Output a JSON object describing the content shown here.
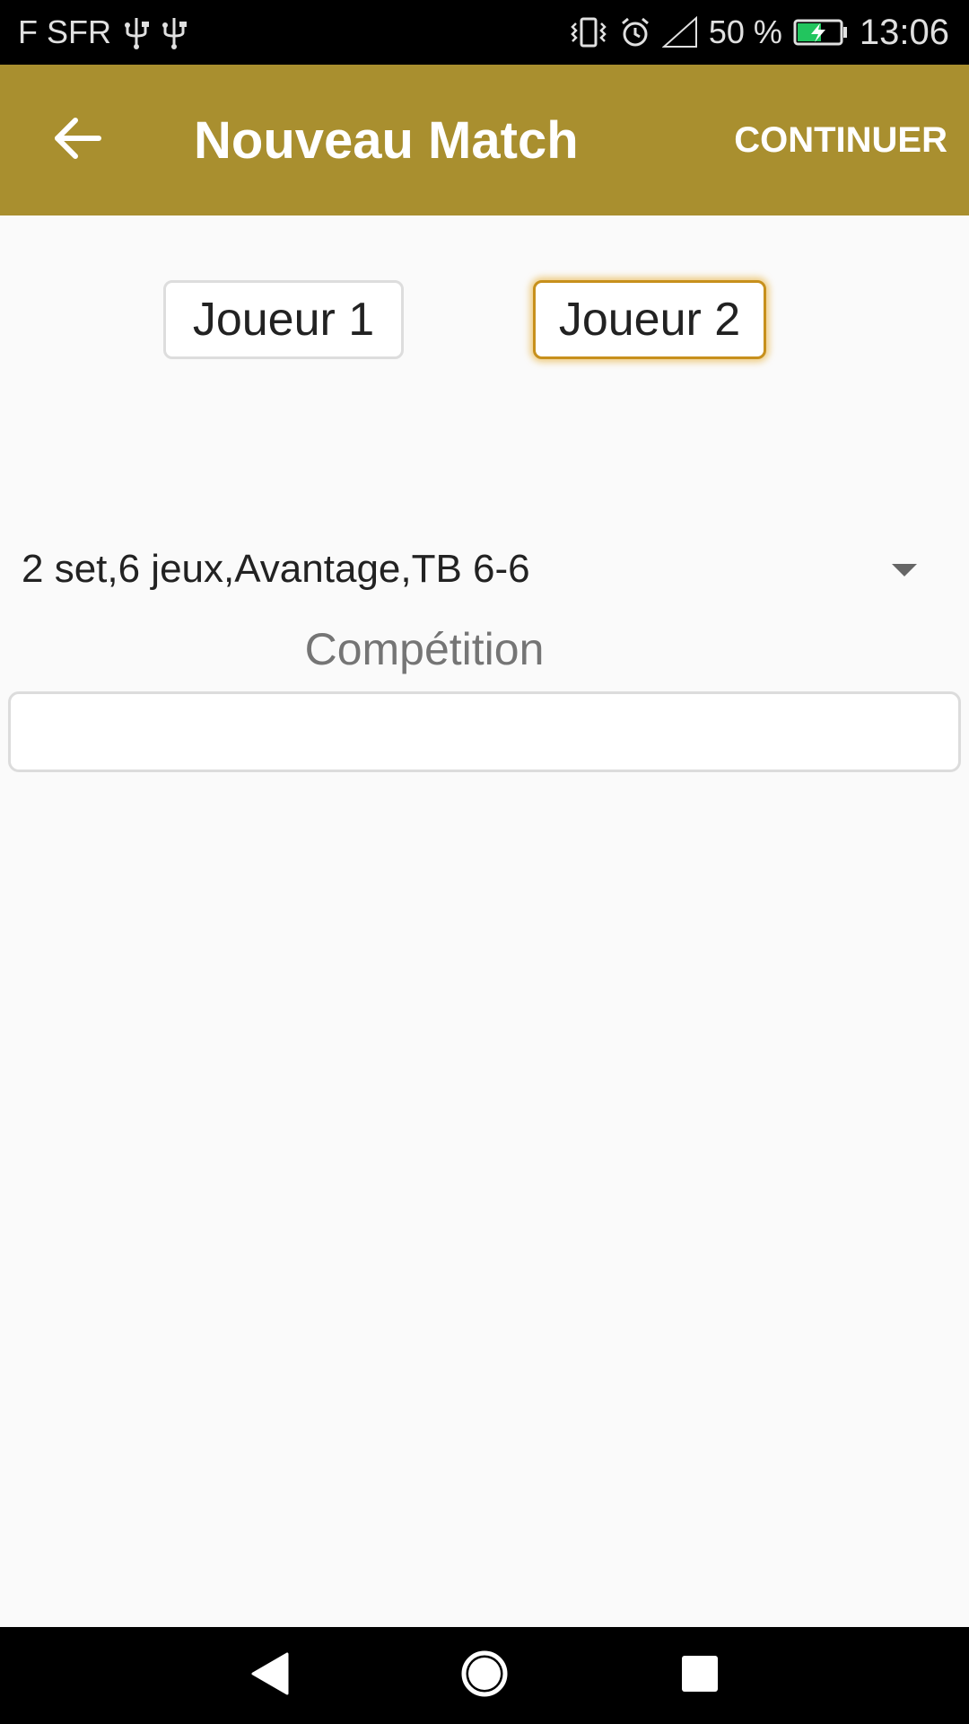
{
  "status_bar": {
    "carrier": "F SFR",
    "battery_percent": "50 %",
    "time": "13:06",
    "icons": [
      "usb-icon",
      "usb-icon",
      "vibrate-icon",
      "alarm-icon",
      "signal-icon",
      "battery-charging-icon"
    ]
  },
  "app_bar": {
    "title": "Nouveau Match",
    "continue_label": "CONTINUER",
    "back_icon": "arrow-left-icon",
    "color": "#a98f2f"
  },
  "players": {
    "player1": "Joueur 1",
    "player2": "Joueur 2"
  },
  "format_select": {
    "selected": "2 set,6 jeux,Avantage,TB 6-6"
  },
  "competition": {
    "label": "Compétition",
    "value": ""
  },
  "nav_bar": {
    "icons": [
      "back-triangle-icon",
      "home-circle-icon",
      "recents-square-icon"
    ]
  }
}
